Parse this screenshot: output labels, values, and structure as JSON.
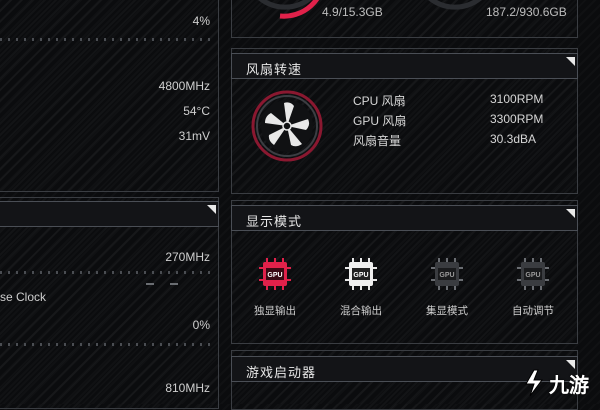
{
  "left": {
    "top_value": "4%",
    "freq1": "4800MHz",
    "temp": "54°C",
    "volt": "31mV",
    "freq2": "270MHz",
    "base_clock_partial": "se Clock",
    "percent2": "0%",
    "freq3": "810MHz"
  },
  "memory": {
    "ram_usage": "4.9/15.3GB",
    "disk_usage": "187.2/930.6GB"
  },
  "fan_panel": {
    "title": "风扇转速",
    "rows": [
      {
        "name": "CPU 风扇",
        "value": "3100RPM"
      },
      {
        "name": "GPU 风扇",
        "value": "3300RPM"
      },
      {
        "name": "风扇音量",
        "value": "30.3dBA"
      }
    ]
  },
  "display_panel": {
    "title": "显示模式",
    "modes": [
      {
        "label": "独显输出",
        "icon": "gpu-chip-icon",
        "active": true
      },
      {
        "label": "混合输出",
        "icon": "gpu-chip-icon",
        "active": false
      },
      {
        "label": "集显模式",
        "icon": "gpu-chip-icon",
        "active": false
      },
      {
        "label": "自动调节",
        "icon": "gpu-chip-icon",
        "active": false
      }
    ],
    "chip_text": "GPU"
  },
  "launcher_panel": {
    "title": "游戏启动器"
  },
  "watermark": {
    "text": "九游"
  },
  "colors": {
    "accent": "#e0214a",
    "panel_border": "#3a3d42",
    "text": "#d8d8d8"
  }
}
